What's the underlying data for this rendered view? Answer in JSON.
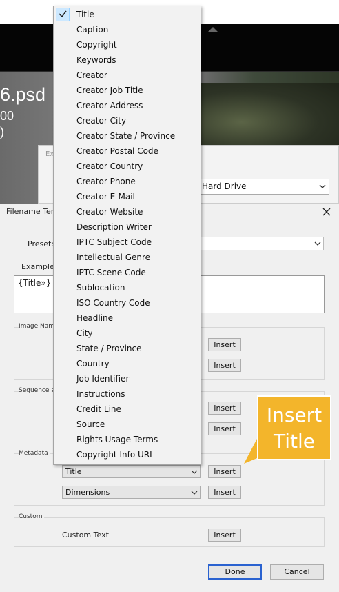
{
  "background": {
    "photo_filename": "6.psd",
    "photo_line1": "00",
    "photo_line2": ")",
    "export_hint": "Ex",
    "export_location": "Hard Drive"
  },
  "dialog": {
    "title": "Filename Ter",
    "preset_label": "Preset:",
    "example_label": "Example:",
    "token_text": "{Title»}",
    "groups": {
      "image_name": "Image Nam",
      "sequence": "Sequence a",
      "metadata": "Metadata",
      "custom": "Custom"
    },
    "insert_label": "Insert",
    "metadata_field1": "Title",
    "metadata_field2": "Dimensions",
    "custom_text_label": "Custom Text",
    "done_button": "Done",
    "cancel_button": "Cancel"
  },
  "menu": {
    "items": [
      "Title",
      "Caption",
      "Copyright",
      "Keywords",
      "Creator",
      "Creator Job Title",
      "Creator Address",
      "Creator City",
      "Creator State / Province",
      "Creator Postal Code",
      "Creator Country",
      "Creator Phone",
      "Creator E-Mail",
      "Creator Website",
      "Description Writer",
      "IPTC Subject Code",
      "Intellectual Genre",
      "IPTC Scene Code",
      "Sublocation",
      "ISO Country Code",
      "Headline",
      "City",
      "State / Province",
      "Country",
      "Job Identifier",
      "Instructions",
      "Credit Line",
      "Source",
      "Rights Usage Terms",
      "Copyright Info URL"
    ],
    "selected": "Title"
  },
  "callout": {
    "line1": "Insert",
    "line2": "Title",
    "color": "#f3b52b"
  },
  "colors": {
    "primary_button_border": "#2a62d0",
    "menu_selected_bg": "#cce8ff"
  }
}
